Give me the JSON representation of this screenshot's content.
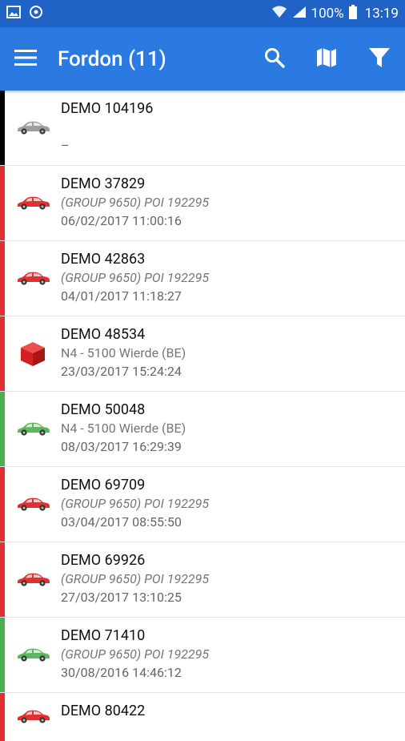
{
  "statusbar": {
    "battery": "100%",
    "time": "13:19"
  },
  "appbar": {
    "title": "Fordon (11)"
  },
  "vehicles": [
    {
      "name": "DEMO 104196",
      "location": "",
      "time": "–",
      "status_color": "#000000",
      "icon": "car-icon",
      "icon_color": "#9e9e9e",
      "italic": false
    },
    {
      "name": "DEMO 37829",
      "location": "(GROUP 9650) POI 192295",
      "time": "06/02/2017 11:00:16",
      "status_color": "#e03030",
      "icon": "car-icon",
      "icon_color": "#e03030",
      "italic": true
    },
    {
      "name": "DEMO 42863",
      "location": "(GROUP 9650) POI 192295",
      "time": "04/01/2017 11:18:27",
      "status_color": "#e03030",
      "icon": "car-icon",
      "icon_color": "#e03030",
      "italic": true
    },
    {
      "name": "DEMO 48534",
      "location": "N4 - 5100 Wierde (BE)",
      "time": "23/03/2017 15:24:24",
      "status_color": "#e03030",
      "icon": "box-icon",
      "icon_color": "#d32020",
      "italic": false
    },
    {
      "name": "DEMO 50048",
      "location": "N4 - 5100 Wierde (BE)",
      "time": "08/03/2017 16:29:39",
      "status_color": "#4caf50",
      "icon": "car-icon",
      "icon_color": "#5cb85c",
      "italic": false
    },
    {
      "name": "DEMO 69709",
      "location": "(GROUP 9650) POI 192295",
      "time": "03/04/2017 08:55:50",
      "status_color": "#e03030",
      "icon": "car-icon",
      "icon_color": "#e03030",
      "italic": true
    },
    {
      "name": "DEMO 69926",
      "location": "(GROUP 9650) POI 192295",
      "time": "27/03/2017 13:10:25",
      "status_color": "#e03030",
      "icon": "car-icon",
      "icon_color": "#e03030",
      "italic": true
    },
    {
      "name": "DEMO 71410",
      "location": "(GROUP 9650) POI 192295",
      "time": "30/08/2016 14:46:12",
      "status_color": "#4caf50",
      "icon": "car-icon",
      "icon_color": "#5cb85c",
      "italic": true
    },
    {
      "name": "DEMO 80422",
      "location": "",
      "time": "",
      "status_color": "#e03030",
      "icon": "car-icon",
      "icon_color": "#e03030",
      "italic": false
    }
  ]
}
